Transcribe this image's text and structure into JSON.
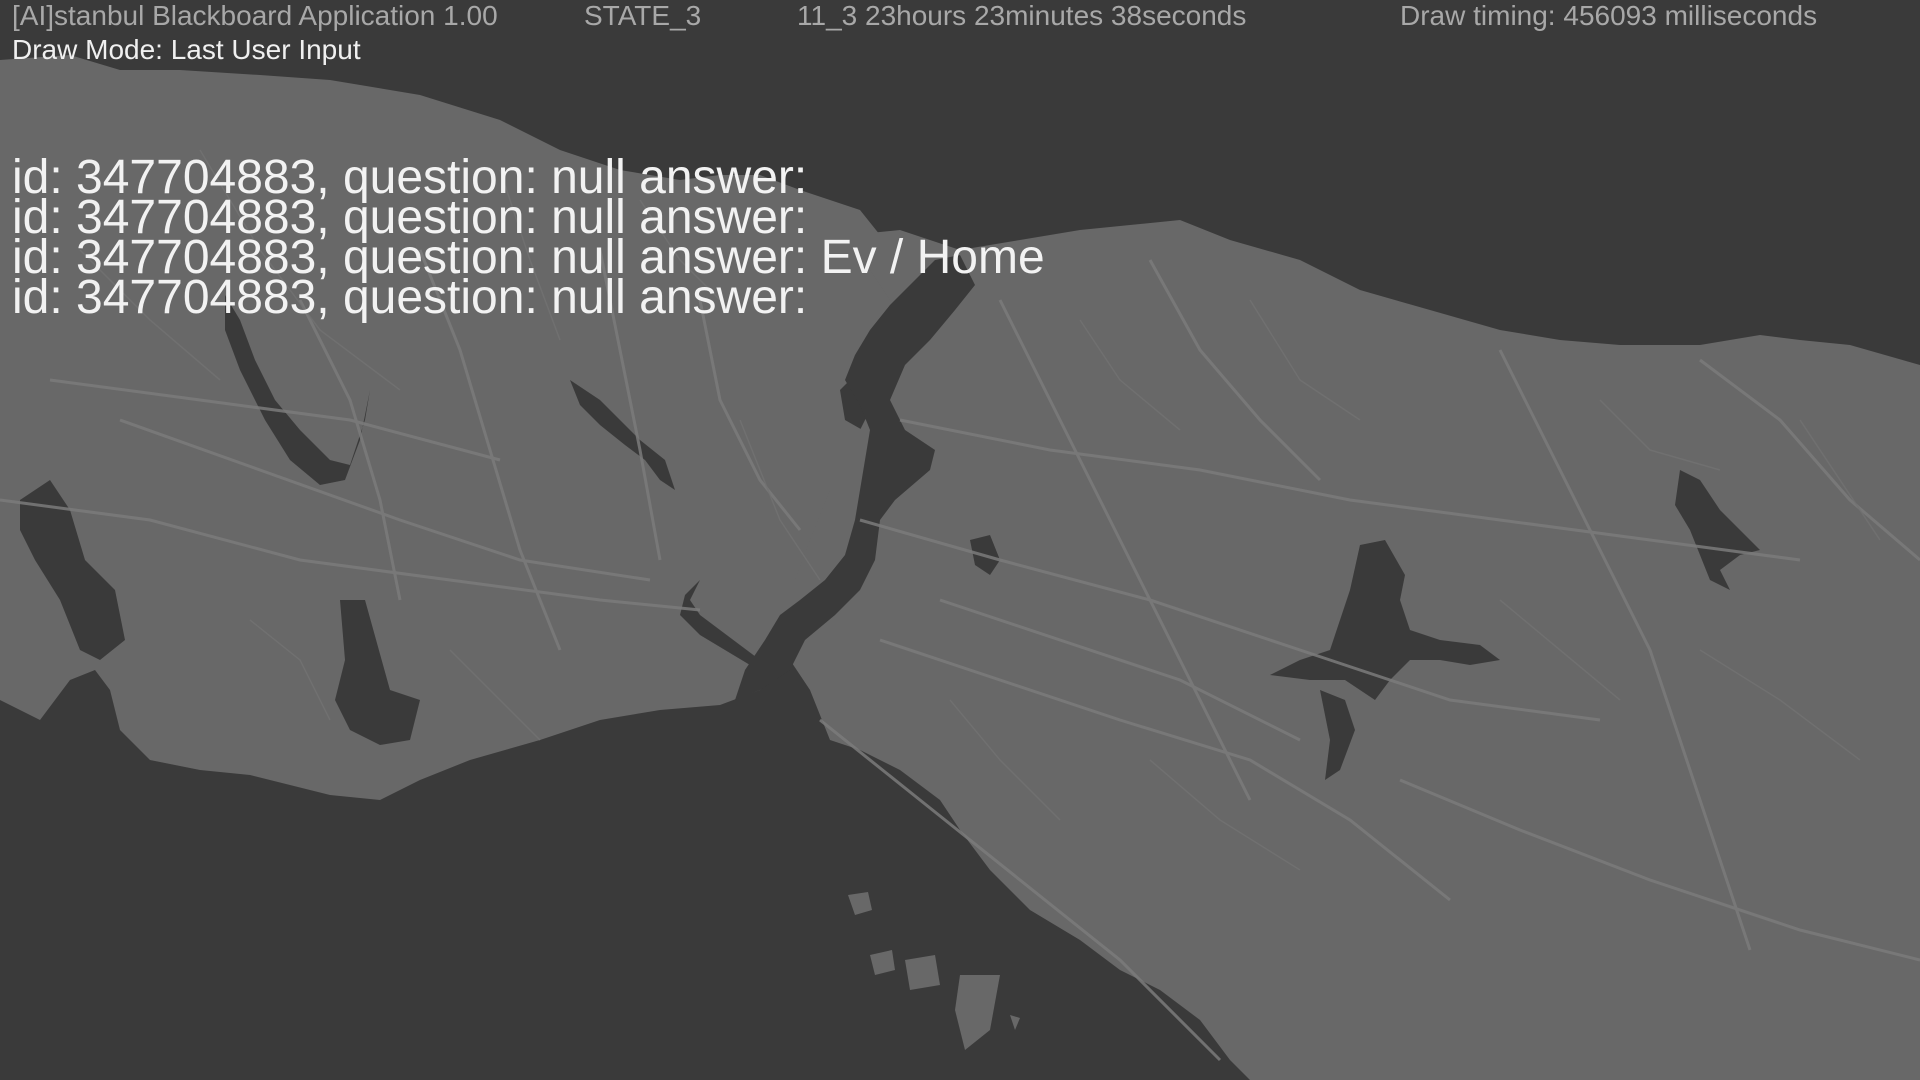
{
  "header": {
    "app_title": "[AI]stanbul Blackboard Application 1.00",
    "state": "STATE_3",
    "clock": "11_3  23hours 23minutes 38seconds",
    "draw_timing": "Draw timing: 456093 milliseconds",
    "draw_mode": "Draw Mode: Last User Input"
  },
  "log": [
    "id: 347704883, question: null answer: ",
    "id: 347704883, question: null answer: ",
    "id: 347704883, question: null answer: Ev / Home",
    "id: 347704883, question: null answer: "
  ],
  "colors": {
    "water": "#3a3a3a",
    "land": "#686868",
    "roads": "#7a7a7a",
    "hud_text": "#a8a8a8",
    "overlay_text": "#f2f2f2"
  }
}
